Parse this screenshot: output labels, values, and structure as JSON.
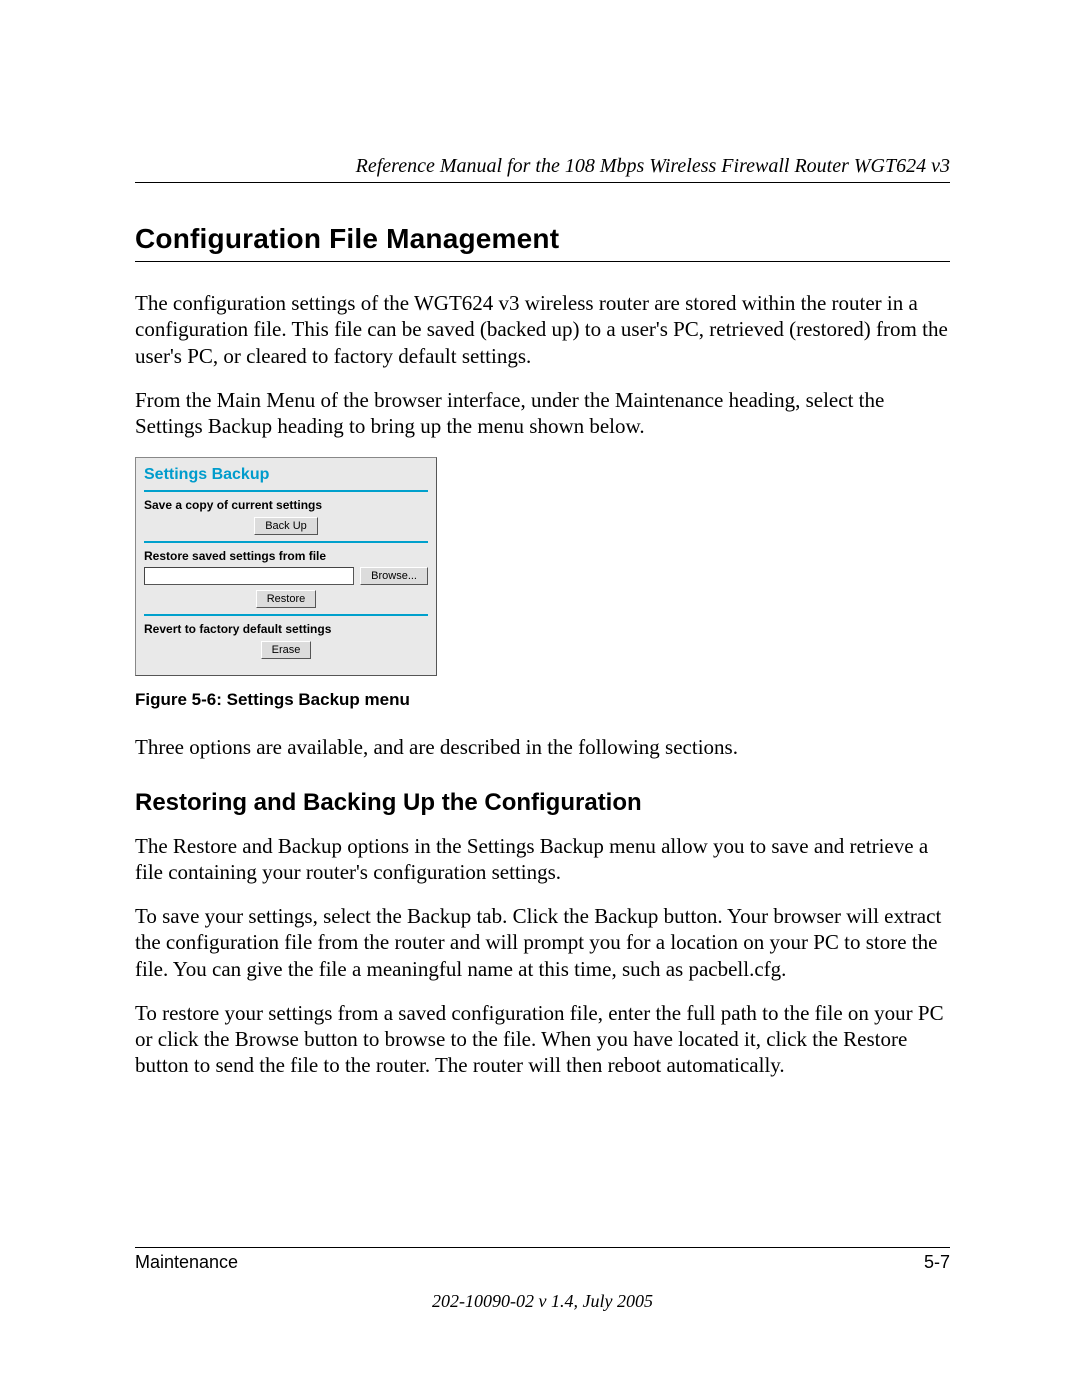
{
  "header": {
    "running_title": "Reference Manual for the 108 Mbps Wireless Firewall Router WGT624 v3"
  },
  "section": {
    "h1": "Configuration File Management",
    "p1": "The configuration settings of the WGT624 v3 wireless router are stored within the router in a configuration file. This file can be saved (backed up) to a user's PC, retrieved (restored) from the user's PC, or cleared to factory default settings.",
    "p2": "From the Main Menu of the browser interface, under the Maintenance heading, select the Settings Backup heading to bring up the menu shown below."
  },
  "panel": {
    "title": "Settings Backup",
    "save_label": "Save a copy of current settings",
    "backup_btn": "Back Up",
    "restore_label": "Restore saved settings from file",
    "browse_btn": "Browse...",
    "restore_btn": "Restore",
    "revert_label": "Revert to factory default settings",
    "erase_btn": "Erase"
  },
  "figure_caption": "Figure 5-6:  Settings Backup menu",
  "after_figure_p": "Three options are available, and are described in the following sections.",
  "subsection": {
    "h2": "Restoring and Backing Up the Configuration",
    "p1": "The Restore and Backup options in the Settings Backup menu allow you to save and retrieve a file containing your router's configuration settings.",
    "p2": "To save your settings, select the Backup tab. Click the Backup button. Your browser will extract the configuration file from the router and will prompt you for a location on your PC to store the file. You can give the file a meaningful name at this time, such as pacbell.cfg.",
    "p3": "To restore your settings from a saved configuration file, enter the full path to the file on your PC or click the Browse button to browse to the file. When you have located it, click the Restore button to send the file to the router. The router will then reboot automatically."
  },
  "footer": {
    "left": "Maintenance",
    "right": "5-7",
    "center": "202-10090-02 v 1.4, July 2005"
  }
}
